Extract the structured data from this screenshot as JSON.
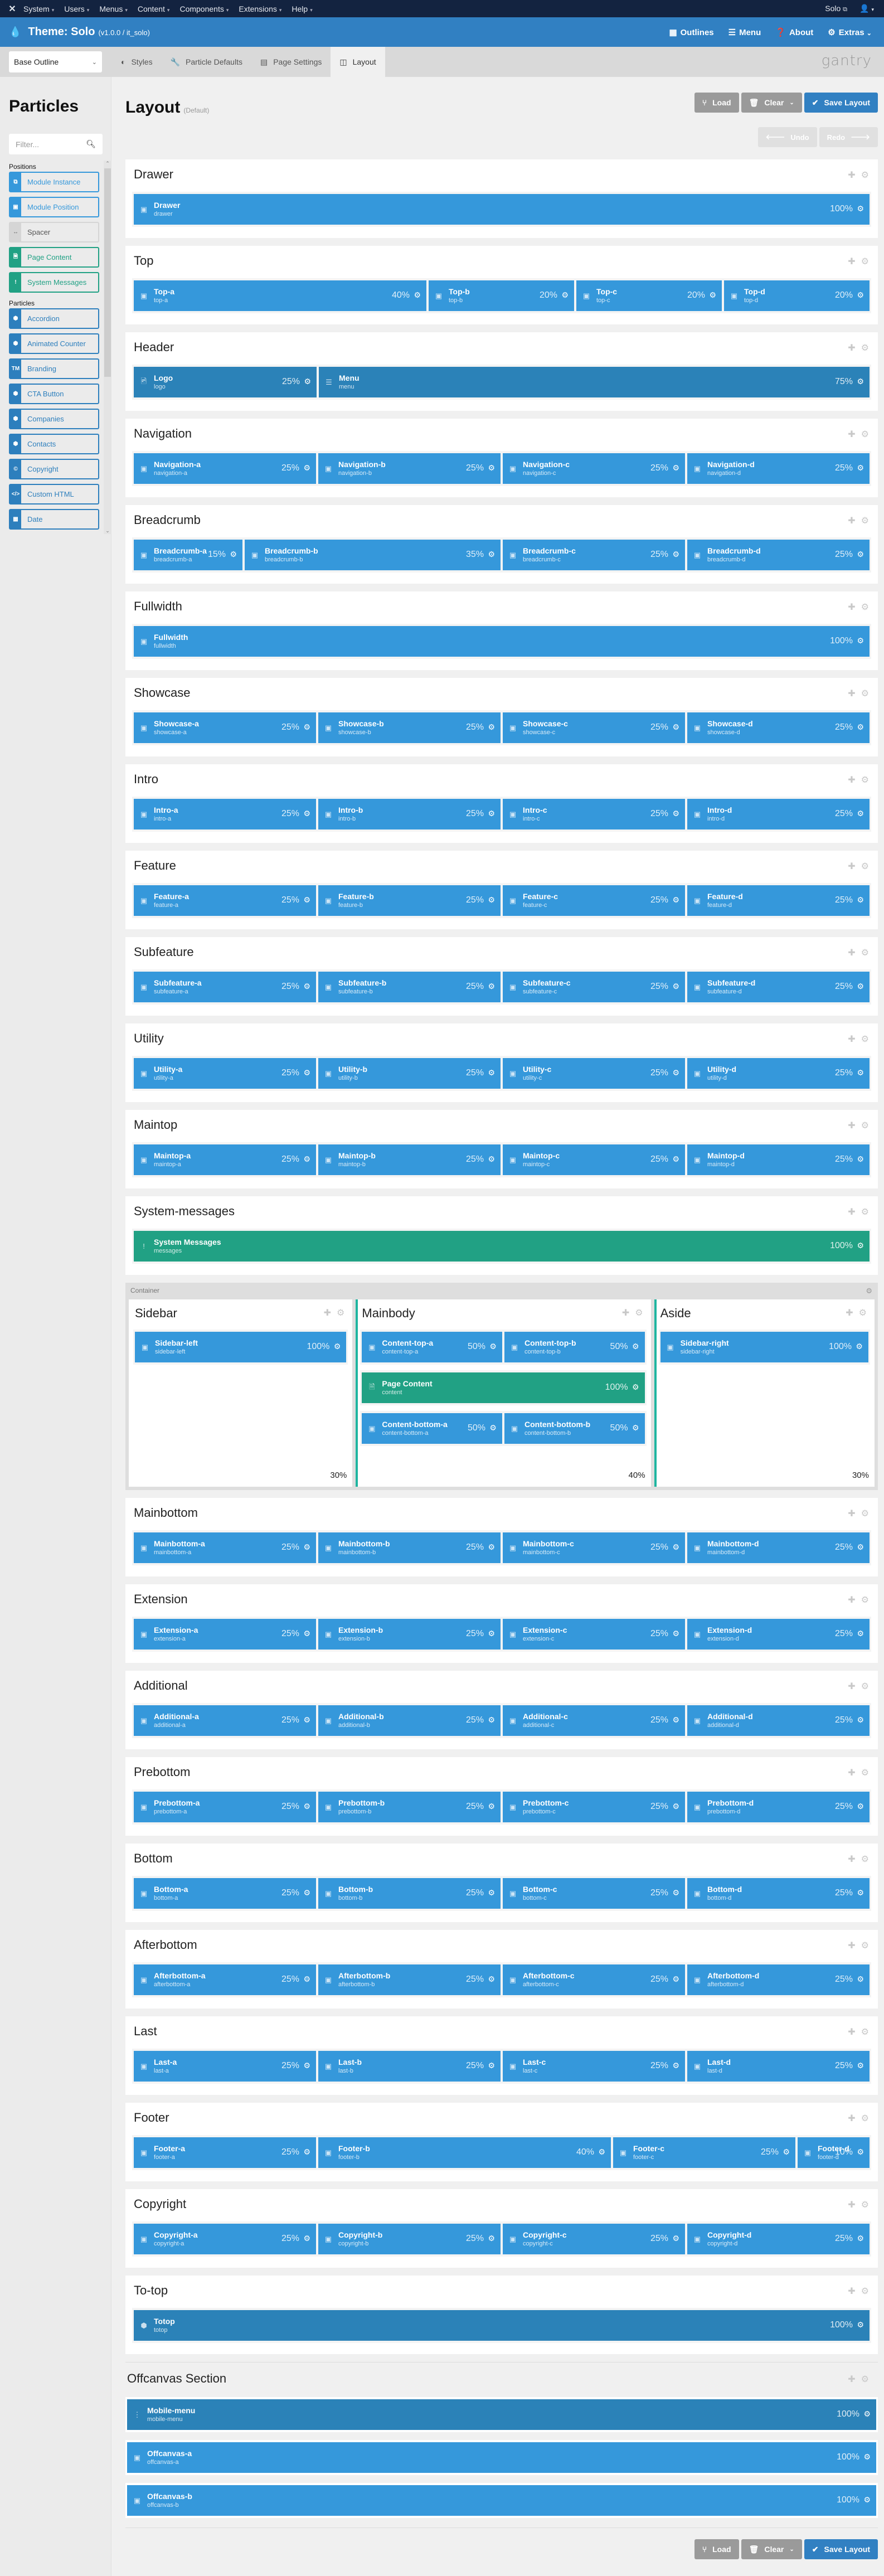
{
  "topbar": {
    "menus": [
      "System",
      "Users",
      "Menus",
      "Content",
      "Components",
      "Extensions",
      "Help"
    ],
    "site_link": "Solo",
    "user_icon": "user-icon"
  },
  "header": {
    "title": "Theme: Solo",
    "version": "(v1.0.0 / it_solo)",
    "nav": [
      {
        "label": "Outlines",
        "icon": "grid-icon"
      },
      {
        "label": "Menu",
        "icon": "bars-icon"
      },
      {
        "label": "About",
        "icon": "question-icon"
      },
      {
        "label": "Extras",
        "icon": "gear-icon"
      }
    ]
  },
  "subnav": {
    "outline_select": "Base Outline",
    "tabs": [
      {
        "label": "Styles",
        "icon": "adjust-icon",
        "active": false
      },
      {
        "label": "Particle Defaults",
        "icon": "wrench-icon",
        "active": false
      },
      {
        "label": "Page Settings",
        "icon": "list-alt-icon",
        "active": false
      },
      {
        "label": "Layout",
        "icon": "columns-icon",
        "active": true
      }
    ],
    "brand": "gantry"
  },
  "sidebar": {
    "title": "Particles",
    "filter_placeholder": "Filter...",
    "groups": [
      {
        "label": "Positions",
        "items": [
          {
            "label": "Module Instance",
            "type": "pos",
            "icon": "⧉"
          },
          {
            "label": "Module Position",
            "type": "pos",
            "icon": "▣"
          },
          {
            "label": "Spacer",
            "type": "spacer",
            "icon": "↔"
          },
          {
            "label": "Page Content",
            "type": "green",
            "icon": "🗎"
          },
          {
            "label": "System Messages",
            "type": "green",
            "icon": "!"
          }
        ]
      },
      {
        "label": "Particles",
        "items": [
          {
            "label": "Accordion",
            "type": "particle",
            "icon": "⬢"
          },
          {
            "label": "Animated Counter",
            "type": "particle",
            "icon": "⬢"
          },
          {
            "label": "Branding",
            "type": "particle",
            "icon": "TM"
          },
          {
            "label": "CTA Button",
            "type": "particle",
            "icon": "⬢"
          },
          {
            "label": "Companies",
            "type": "particle",
            "icon": "⬢"
          },
          {
            "label": "Contacts",
            "type": "particle",
            "icon": "⬢"
          },
          {
            "label": "Copyright",
            "type": "particle",
            "icon": "©"
          },
          {
            "label": "Custom HTML",
            "type": "particle",
            "icon": "</>"
          },
          {
            "label": "Date",
            "type": "particle",
            "icon": "▦"
          }
        ]
      }
    ]
  },
  "main": {
    "title": "Layout",
    "subtitle": "(Default)",
    "actions": {
      "load": "Load",
      "clear": "Clear",
      "save": "Save Layout"
    },
    "undo": "Undo",
    "redo": "Redo",
    "sections_top": [
      {
        "name": "Drawer",
        "blocks": [
          {
            "title": "Drawer",
            "key": "drawer",
            "pct": 100,
            "style": "pos"
          }
        ]
      },
      {
        "name": "Top",
        "blocks": [
          {
            "title": "Top-a",
            "key": "top-a",
            "pct": 40,
            "style": "pos"
          },
          {
            "title": "Top-b",
            "key": "top-b",
            "pct": 20,
            "style": "pos"
          },
          {
            "title": "Top-c",
            "key": "top-c",
            "pct": 20,
            "style": "pos"
          },
          {
            "title": "Top-d",
            "key": "top-d",
            "pct": 20,
            "style": "pos"
          }
        ]
      },
      {
        "name": "Header",
        "blocks": [
          {
            "title": "Logo",
            "key": "logo",
            "pct": 25,
            "style": "logo"
          },
          {
            "title": "Menu",
            "key": "menu",
            "pct": 75,
            "style": "menu"
          }
        ]
      },
      {
        "name": "Navigation",
        "blocks": [
          {
            "title": "Navigation-a",
            "key": "navigation-a",
            "pct": 25,
            "style": "pos"
          },
          {
            "title": "Navigation-b",
            "key": "navigation-b",
            "pct": 25,
            "style": "pos"
          },
          {
            "title": "Navigation-c",
            "key": "navigation-c",
            "pct": 25,
            "style": "pos"
          },
          {
            "title": "Navigation-d",
            "key": "navigation-d",
            "pct": 25,
            "style": "pos"
          }
        ]
      },
      {
        "name": "Breadcrumb",
        "blocks": [
          {
            "title": "Breadcrumb-a",
            "key": "breadcrumb-a",
            "pct": 15,
            "style": "pos"
          },
          {
            "title": "Breadcrumb-b",
            "key": "breadcrumb-b",
            "pct": 35,
            "style": "pos"
          },
          {
            "title": "Breadcrumb-c",
            "key": "breadcrumb-c",
            "pct": 25,
            "style": "pos"
          },
          {
            "title": "Breadcrumb-d",
            "key": "breadcrumb-d",
            "pct": 25,
            "style": "pos"
          }
        ]
      },
      {
        "name": "Fullwidth",
        "blocks": [
          {
            "title": "Fullwidth",
            "key": "fullwidth",
            "pct": 100,
            "style": "pos"
          }
        ]
      },
      {
        "name": "Showcase",
        "blocks": [
          {
            "title": "Showcase-a",
            "key": "showcase-a",
            "pct": 25,
            "style": "pos"
          },
          {
            "title": "Showcase-b",
            "key": "showcase-b",
            "pct": 25,
            "style": "pos"
          },
          {
            "title": "Showcase-c",
            "key": "showcase-c",
            "pct": 25,
            "style": "pos"
          },
          {
            "title": "Showcase-d",
            "key": "showcase-d",
            "pct": 25,
            "style": "pos"
          }
        ]
      },
      {
        "name": "Intro",
        "blocks": [
          {
            "title": "Intro-a",
            "key": "intro-a",
            "pct": 25,
            "style": "pos"
          },
          {
            "title": "Intro-b",
            "key": "intro-b",
            "pct": 25,
            "style": "pos"
          },
          {
            "title": "Intro-c",
            "key": "intro-c",
            "pct": 25,
            "style": "pos"
          },
          {
            "title": "Intro-d",
            "key": "intro-d",
            "pct": 25,
            "style": "pos"
          }
        ]
      },
      {
        "name": "Feature",
        "blocks": [
          {
            "title": "Feature-a",
            "key": "feature-a",
            "pct": 25,
            "style": "pos"
          },
          {
            "title": "Feature-b",
            "key": "feature-b",
            "pct": 25,
            "style": "pos"
          },
          {
            "title": "Feature-c",
            "key": "feature-c",
            "pct": 25,
            "style": "pos"
          },
          {
            "title": "Feature-d",
            "key": "feature-d",
            "pct": 25,
            "style": "pos"
          }
        ]
      },
      {
        "name": "Subfeature",
        "blocks": [
          {
            "title": "Subfeature-a",
            "key": "subfeature-a",
            "pct": 25,
            "style": "pos"
          },
          {
            "title": "Subfeature-b",
            "key": "subfeature-b",
            "pct": 25,
            "style": "pos"
          },
          {
            "title": "Subfeature-c",
            "key": "subfeature-c",
            "pct": 25,
            "style": "pos"
          },
          {
            "title": "Subfeature-d",
            "key": "subfeature-d",
            "pct": 25,
            "style": "pos"
          }
        ]
      },
      {
        "name": "Utility",
        "blocks": [
          {
            "title": "Utility-a",
            "key": "utility-a",
            "pct": 25,
            "style": "pos"
          },
          {
            "title": "Utility-b",
            "key": "utility-b",
            "pct": 25,
            "style": "pos"
          },
          {
            "title": "Utility-c",
            "key": "utility-c",
            "pct": 25,
            "style": "pos"
          },
          {
            "title": "Utility-d",
            "key": "utility-d",
            "pct": 25,
            "style": "pos"
          }
        ]
      },
      {
        "name": "Maintop",
        "blocks": [
          {
            "title": "Maintop-a",
            "key": "maintop-a",
            "pct": 25,
            "style": "pos"
          },
          {
            "title": "Maintop-b",
            "key": "maintop-b",
            "pct": 25,
            "style": "pos"
          },
          {
            "title": "Maintop-c",
            "key": "maintop-c",
            "pct": 25,
            "style": "pos"
          },
          {
            "title": "Maintop-d",
            "key": "maintop-d",
            "pct": 25,
            "style": "pos"
          }
        ]
      },
      {
        "name": "System-messages",
        "blocks": [
          {
            "title": "System Messages",
            "key": "messages",
            "pct": 100,
            "style": "messages"
          }
        ]
      }
    ],
    "container": {
      "label": "Container",
      "columns": [
        {
          "name": "Sidebar",
          "pct": 30,
          "rows": [
            [
              {
                "title": "Sidebar-left",
                "key": "sidebar-left",
                "pct": 100,
                "style": "pos"
              }
            ]
          ]
        },
        {
          "name": "Mainbody",
          "pct": 40,
          "rows": [
            [
              {
                "title": "Content-top-a",
                "key": "content-top-a",
                "pct": 50,
                "style": "pos"
              },
              {
                "title": "Content-top-b",
                "key": "content-top-b",
                "pct": 50,
                "style": "pos"
              }
            ],
            [
              {
                "title": "Page Content",
                "key": "content",
                "pct": 100,
                "style": "content"
              }
            ],
            [
              {
                "title": "Content-bottom-a",
                "key": "content-bottom-a",
                "pct": 50,
                "style": "pos"
              },
              {
                "title": "Content-bottom-b",
                "key": "content-bottom-b",
                "pct": 50,
                "style": "pos"
              }
            ]
          ]
        },
        {
          "name": "Aside",
          "pct": 30,
          "rows": [
            [
              {
                "title": "Sidebar-right",
                "key": "sidebar-right",
                "pct": 100,
                "style": "pos"
              }
            ]
          ]
        }
      ]
    },
    "sections_bottom": [
      {
        "name": "Mainbottom",
        "blocks": [
          {
            "title": "Mainbottom-a",
            "key": "mainbottom-a",
            "pct": 25,
            "style": "pos"
          },
          {
            "title": "Mainbottom-b",
            "key": "mainbottom-b",
            "pct": 25,
            "style": "pos"
          },
          {
            "title": "Mainbottom-c",
            "key": "mainbottom-c",
            "pct": 25,
            "style": "pos"
          },
          {
            "title": "Mainbottom-d",
            "key": "mainbottom-d",
            "pct": 25,
            "style": "pos"
          }
        ]
      },
      {
        "name": "Extension",
        "blocks": [
          {
            "title": "Extension-a",
            "key": "extension-a",
            "pct": 25,
            "style": "pos"
          },
          {
            "title": "Extension-b",
            "key": "extension-b",
            "pct": 25,
            "style": "pos"
          },
          {
            "title": "Extension-c",
            "key": "extension-c",
            "pct": 25,
            "style": "pos"
          },
          {
            "title": "Extension-d",
            "key": "extension-d",
            "pct": 25,
            "style": "pos"
          }
        ]
      },
      {
        "name": "Additional",
        "blocks": [
          {
            "title": "Additional-a",
            "key": "additional-a",
            "pct": 25,
            "style": "pos"
          },
          {
            "title": "Additional-b",
            "key": "additional-b",
            "pct": 25,
            "style": "pos"
          },
          {
            "title": "Additional-c",
            "key": "additional-c",
            "pct": 25,
            "style": "pos"
          },
          {
            "title": "Additional-d",
            "key": "additional-d",
            "pct": 25,
            "style": "pos"
          }
        ]
      },
      {
        "name": "Prebottom",
        "blocks": [
          {
            "title": "Prebottom-a",
            "key": "prebottom-a",
            "pct": 25,
            "style": "pos"
          },
          {
            "title": "Prebottom-b",
            "key": "prebottom-b",
            "pct": 25,
            "style": "pos"
          },
          {
            "title": "Prebottom-c",
            "key": "prebottom-c",
            "pct": 25,
            "style": "pos"
          },
          {
            "title": "Prebottom-d",
            "key": "prebottom-d",
            "pct": 25,
            "style": "pos"
          }
        ]
      },
      {
        "name": "Bottom",
        "blocks": [
          {
            "title": "Bottom-a",
            "key": "bottom-a",
            "pct": 25,
            "style": "pos"
          },
          {
            "title": "Bottom-b",
            "key": "bottom-b",
            "pct": 25,
            "style": "pos"
          },
          {
            "title": "Bottom-c",
            "key": "bottom-c",
            "pct": 25,
            "style": "pos"
          },
          {
            "title": "Bottom-d",
            "key": "bottom-d",
            "pct": 25,
            "style": "pos"
          }
        ]
      },
      {
        "name": "Afterbottom",
        "blocks": [
          {
            "title": "Afterbottom-a",
            "key": "afterbottom-a",
            "pct": 25,
            "style": "pos"
          },
          {
            "title": "Afterbottom-b",
            "key": "afterbottom-b",
            "pct": 25,
            "style": "pos"
          },
          {
            "title": "Afterbottom-c",
            "key": "afterbottom-c",
            "pct": 25,
            "style": "pos"
          },
          {
            "title": "Afterbottom-d",
            "key": "afterbottom-d",
            "pct": 25,
            "style": "pos"
          }
        ]
      },
      {
        "name": "Last",
        "blocks": [
          {
            "title": "Last-a",
            "key": "last-a",
            "pct": 25,
            "style": "pos"
          },
          {
            "title": "Last-b",
            "key": "last-b",
            "pct": 25,
            "style": "pos"
          },
          {
            "title": "Last-c",
            "key": "last-c",
            "pct": 25,
            "style": "pos"
          },
          {
            "title": "Last-d",
            "key": "last-d",
            "pct": 25,
            "style": "pos"
          }
        ]
      },
      {
        "name": "Footer",
        "blocks": [
          {
            "title": "Footer-a",
            "key": "footer-a",
            "pct": 25,
            "style": "pos"
          },
          {
            "title": "Footer-b",
            "key": "footer-b",
            "pct": 40,
            "style": "pos"
          },
          {
            "title": "Footer-c",
            "key": "footer-c",
            "pct": 25,
            "style": "pos"
          },
          {
            "title": "Footer-d",
            "key": "footer-d",
            "pct": 10,
            "style": "pos"
          }
        ]
      },
      {
        "name": "Copyright",
        "blocks": [
          {
            "title": "Copyright-a",
            "key": "copyright-a",
            "pct": 25,
            "style": "pos"
          },
          {
            "title": "Copyright-b",
            "key": "copyright-b",
            "pct": 25,
            "style": "pos"
          },
          {
            "title": "Copyright-c",
            "key": "copyright-c",
            "pct": 25,
            "style": "pos"
          },
          {
            "title": "Copyright-d",
            "key": "copyright-d",
            "pct": 25,
            "style": "pos"
          }
        ]
      },
      {
        "name": "To-top",
        "blocks": [
          {
            "title": "Totop",
            "key": "totop",
            "pct": 100,
            "style": "totop"
          }
        ]
      }
    ],
    "offcanvas": {
      "name": "Offcanvas Section",
      "rows": [
        [
          {
            "title": "Mobile-menu",
            "key": "mobile-menu",
            "pct": 100,
            "style": "mobile"
          }
        ],
        [
          {
            "title": "Offcanvas-a",
            "key": "offcanvas-a",
            "pct": 100,
            "style": "pos"
          }
        ],
        [
          {
            "title": "Offcanvas-b",
            "key": "offcanvas-b",
            "pct": 100,
            "style": "pos"
          }
        ]
      ]
    }
  },
  "colors": {
    "topbar": "#132340",
    "header": "#3180c2",
    "position_block": "#3598db",
    "particle_block": "#2b82b8",
    "content_block": "#21a184",
    "save_button": "#3180c2",
    "grey_button": "#9a9a9a"
  }
}
